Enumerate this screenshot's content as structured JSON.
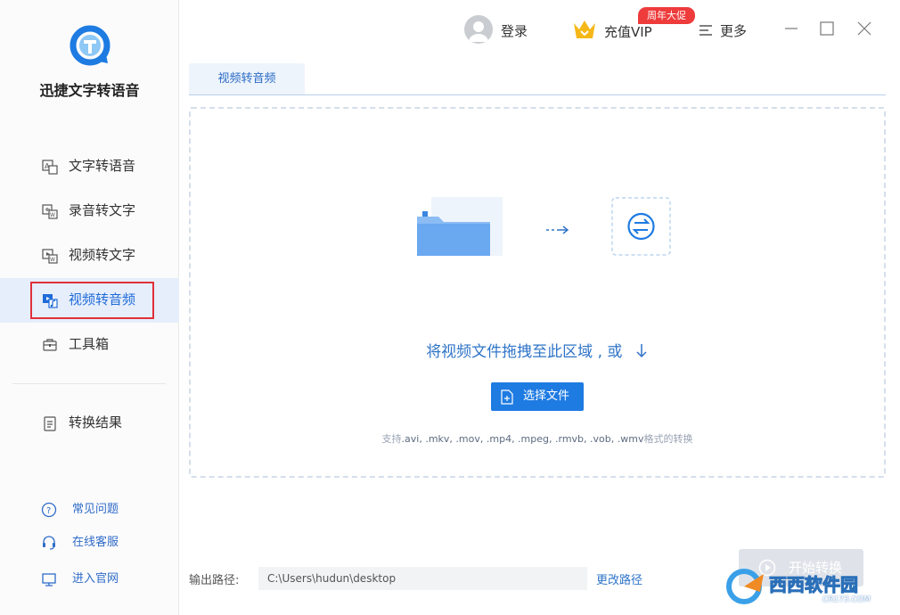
{
  "app": {
    "title": "迅捷文字转语音",
    "accent_color": "#1e7be2"
  },
  "sidebar": {
    "nav_items": [
      {
        "label": "文字转语音",
        "icon": "text-to-speech-icon",
        "active": false
      },
      {
        "label": "录音转文字",
        "icon": "recording-to-text-icon",
        "active": false
      },
      {
        "label": "视频转文字",
        "icon": "video-to-text-icon",
        "active": false
      },
      {
        "label": "视频转音频",
        "icon": "video-to-audio-icon",
        "active": true
      },
      {
        "label": "工具箱",
        "icon": "toolbox-icon",
        "active": false
      }
    ],
    "results_item": {
      "label": "转换结果",
      "icon": "results-list-icon"
    },
    "help_items": [
      {
        "label": "常见问题",
        "icon": "question-icon"
      },
      {
        "label": "在线客服",
        "icon": "headset-icon"
      },
      {
        "label": "进入官网",
        "icon": "monitor-icon"
      }
    ]
  },
  "header": {
    "login_label": "登录",
    "vip_label": "充值VIP",
    "promo_badge": "周年大促",
    "more_label": "更多"
  },
  "tabs": [
    {
      "label": "视频转音频",
      "active": true
    }
  ],
  "dropzone": {
    "hint": "将视频文件拖拽至此区域 , 或",
    "choose_button_label": "选择文件",
    "support_prefix": "支持",
    "support_formats": ".avi, .mkv, .mov, .mp4, .mpeg, .rmvb, .vob, .wmv",
    "support_suffix": "格式的转换"
  },
  "footer": {
    "output_label": "输出路径:",
    "output_path": "C:\\Users\\hudun\\desktop",
    "change_path_label": "更改路径",
    "start_button_label": "开始转换"
  },
  "watermark": {
    "text": "西西软件园",
    "url": "CR173.COM"
  }
}
